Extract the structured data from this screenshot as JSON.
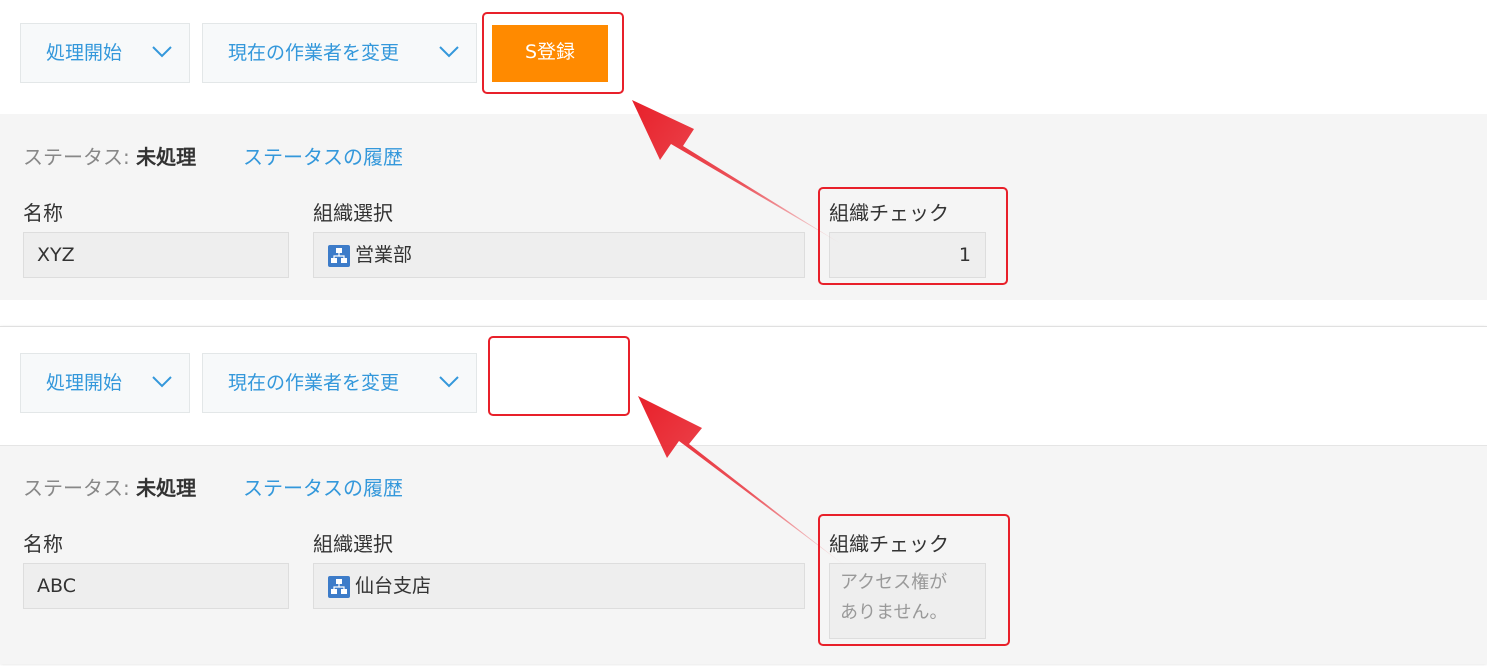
{
  "records": [
    {
      "toolbar": {
        "process_start": "処理開始",
        "change_assignee": "現在の作業者を変更",
        "s_register": "S登録"
      },
      "status_label": "ステータス:",
      "status_value": "未処理",
      "status_history": "ステータスの履歴",
      "fields": {
        "name_label": "名称",
        "name_value": "XYZ",
        "org_label": "組織選択",
        "org_value": "営業部",
        "check_label": "組織チェック",
        "check_value": "1"
      }
    },
    {
      "toolbar": {
        "process_start": "処理開始",
        "change_assignee": "現在の作業者を変更"
      },
      "status_label": "ステータス:",
      "status_value": "未処理",
      "status_history": "ステータスの履歴",
      "fields": {
        "name_label": "名称",
        "name_value": "ABC",
        "org_label": "組織選択",
        "org_value": "仙台支店",
        "check_label": "組織チェック",
        "check_value_line1": "アクセス権が",
        "check_value_line2": "ありません。"
      }
    }
  ],
  "colors": {
    "accent_blue": "#3498db",
    "button_orange": "#ff8a00",
    "highlight_red": "#e8202a",
    "panel_gray": "#f5f5f5"
  },
  "icons": {
    "dropdown": "chevron-down-icon",
    "organization": "organization-icon",
    "annotation": "arrow-annotation-icon"
  }
}
